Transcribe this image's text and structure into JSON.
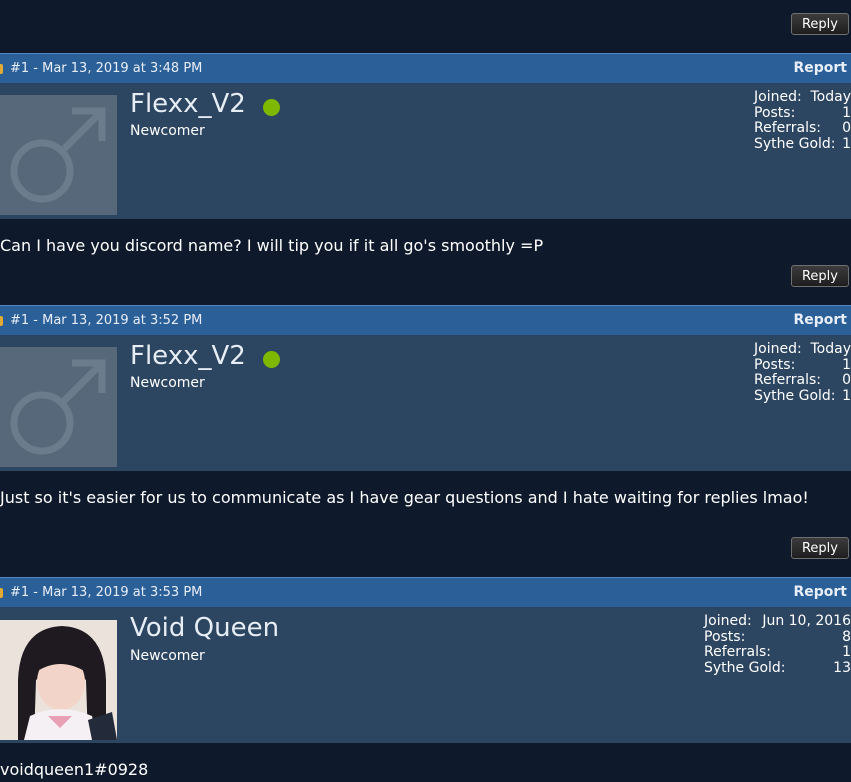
{
  "actions": {
    "reply_label": "Reply",
    "report_label": "Report"
  },
  "posts": [
    {
      "header": "#1 - Mar 13, 2019 at 3:48 PM",
      "username": "Flexx_V2",
      "online": true,
      "rank": "Newcomer",
      "avatar": "default-male-avatar",
      "stats": {
        "joined_label": "Joined:",
        "joined": "Today",
        "posts_label": "Posts:",
        "posts": "1",
        "referrals_label": "Referrals:",
        "referrals": "0",
        "gold_label": "Sythe Gold:",
        "gold": "1"
      },
      "body": "Can I have you discord name? I will tip you if it all go's smoothly =P"
    },
    {
      "header": "#1 - Mar 13, 2019 at 3:52 PM",
      "username": "Flexx_V2",
      "online": true,
      "rank": "Newcomer",
      "avatar": "default-male-avatar",
      "stats": {
        "joined_label": "Joined:",
        "joined": "Today",
        "posts_label": "Posts:",
        "posts": "1",
        "referrals_label": "Referrals:",
        "referrals": "0",
        "gold_label": "Sythe Gold:",
        "gold": "1"
      },
      "body": "Just so it's easier for us to communicate as I have gear questions and I hate waiting for replies lmao!"
    },
    {
      "header": "#1 - Mar 13, 2019 at 3:53 PM",
      "username": "Void Queen",
      "online": false,
      "rank": "Newcomer",
      "avatar": "user-photo-avatar",
      "stats": {
        "joined_label": "Joined:",
        "joined": "Jun 10, 2016",
        "posts_label": "Posts:",
        "posts": "8",
        "referrals_label": "Referrals:",
        "referrals": "1",
        "gold_label": "Sythe Gold:",
        "gold": "13"
      },
      "body": "voidqueen1#0928"
    }
  ],
  "colors": {
    "page_bg": "#0e1a2b",
    "header_bar": "#2b5f98",
    "user_panel": "#2c4560",
    "online": "#7fb800"
  }
}
